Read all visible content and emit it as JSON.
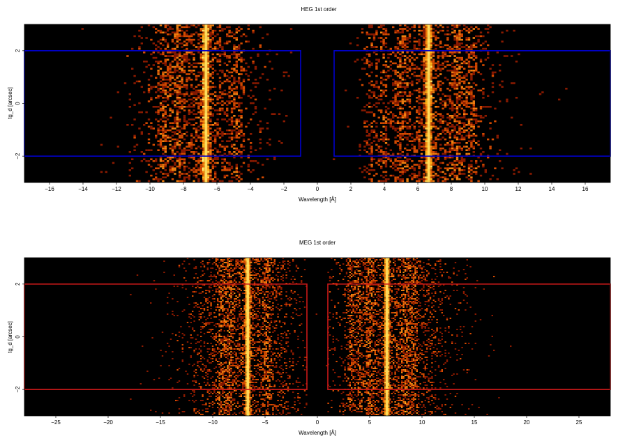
{
  "chart_data": [
    {
      "type": "heatmap",
      "title": "HEG 1st order",
      "xlabel": "Wavelength [Å]",
      "ylabel": "tg_d [arcsec]",
      "xlim": [
        -17.5,
        17.5
      ],
      "ylim": [
        -3,
        3
      ],
      "xticks": [
        -16,
        -14,
        -12,
        -10,
        -8,
        -6,
        -4,
        -2,
        0,
        2,
        4,
        6,
        8,
        10,
        12,
        14,
        16
      ],
      "xtick_labels": [
        "−16",
        "−14",
        "−12",
        "−10",
        "−8",
        "−6",
        "−4",
        "−2",
        "0",
        "2",
        "4",
        "6",
        "8",
        "10",
        "12",
        "14",
        "16"
      ],
      "yticks": [
        -2,
        0,
        2
      ],
      "ytick_labels": [
        "−2",
        "0",
        "2"
      ],
      "background": "#000000",
      "colormap": [
        "#000000",
        "#8a1a00",
        "#d44a00",
        "#f08010",
        "#ffc020",
        "#ffff80"
      ],
      "bright_lines": [
        -6.65,
        6.65
      ],
      "emission_bands": [
        -9.2,
        -8.4,
        -4.8,
        3.2,
        4.0,
        5.0,
        8.4,
        9.2
      ],
      "source_windows": [
        [
          -17.5,
          -1.0,
          -2.0,
          2.0
        ],
        [
          1.0,
          17.5,
          -2.0,
          2.0
        ]
      ],
      "window_color": "#0000cc"
    },
    {
      "type": "heatmap",
      "title": "MEG 1st order",
      "xlabel": "Wavelength [Å]",
      "ylabel": "tg_d [arcsec]",
      "xlim": [
        -28,
        28
      ],
      "ylim": [
        -3,
        3
      ],
      "xticks": [
        -25,
        -20,
        -15,
        -10,
        -5,
        0,
        5,
        10,
        15,
        20,
        25
      ],
      "xtick_labels": [
        "−25",
        "−20",
        "−15",
        "−10",
        "−5",
        "0",
        "5",
        "10",
        "15",
        "20",
        "25"
      ],
      "yticks": [
        -2,
        0,
        2
      ],
      "ytick_labels": [
        "−2",
        "0",
        "2"
      ],
      "background": "#000000",
      "colormap": [
        "#000000",
        "#8a1a00",
        "#d44a00",
        "#f08010",
        "#ffc020",
        "#ffff80"
      ],
      "bright_lines": [
        -6.65,
        6.65
      ],
      "emission_bands": [
        -9.2,
        -8.4,
        -4.8,
        3.2,
        4.0,
        5.0,
        8.4,
        9.2
      ],
      "source_windows": [
        [
          -28,
          -1.0,
          -2.0,
          2.0
        ],
        [
          1.0,
          28,
          -2.0,
          2.0
        ]
      ],
      "window_color": "#cc1a1a"
    }
  ]
}
